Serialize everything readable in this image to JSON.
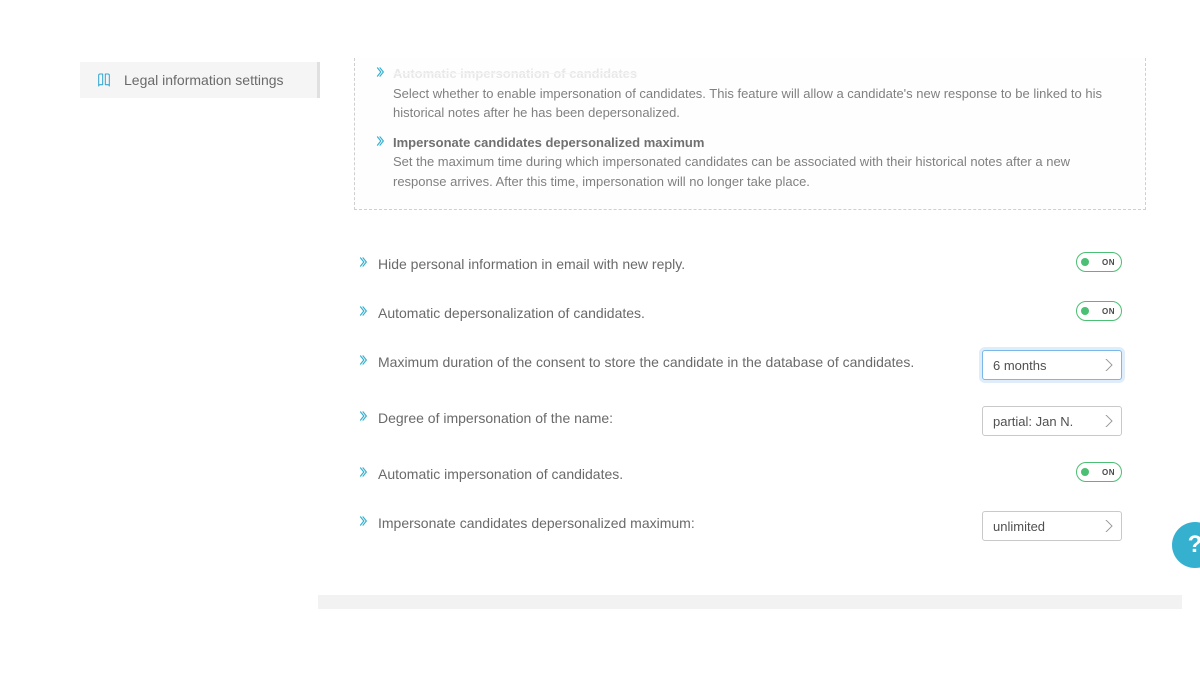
{
  "sidebar": {
    "items": [
      {
        "label": "Legal information settings"
      }
    ]
  },
  "helpbox": {
    "items": [
      {
        "title": "Automatic impersonation of candidates",
        "body": "Select whether to enable impersonation of candidates. This feature will allow a candidate's new response to be linked to his historical notes after he has been depersonalized."
      },
      {
        "title": "Impersonate candidates depersonalized maximum",
        "body": "Set the maximum time during which impersonated candidates can be associated with their historical notes after a new response arrives. After this time, impersonation will no longer take place."
      }
    ]
  },
  "settings": {
    "hide_personal": {
      "label": "Hide personal information in email with new reply.",
      "state": "ON"
    },
    "auto_depersonalize": {
      "label": "Automatic depersonalization of candidates.",
      "state": "ON"
    },
    "max_duration": {
      "label": "Maximum duration of the consent to store the candidate in the database of candidates.",
      "value": "6 months"
    },
    "degree_impersonation": {
      "label": "Degree of impersonation of the name:",
      "value": "partial: Jan N."
    },
    "auto_impersonation": {
      "label": "Automatic impersonation of candidates.",
      "state": "ON"
    },
    "imp_dep_max": {
      "label": "Impersonate candidates depersonalized maximum:",
      "value": "unlimited"
    }
  },
  "fab": {
    "glyph": "?"
  }
}
